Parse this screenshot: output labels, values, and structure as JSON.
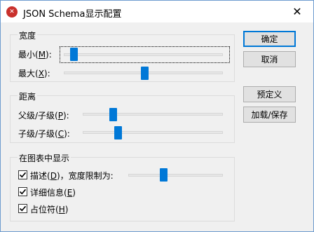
{
  "window": {
    "title": "JSON Schema显示配置",
    "close_glyph": "✕"
  },
  "width_group": {
    "title": "宽度",
    "min_prefix": "最小(",
    "min_key": "M",
    "min_suffix": "):",
    "min_value": 0.04,
    "max_prefix": "最大(",
    "max_key": "X",
    "max_suffix": "):",
    "max_value": 0.51
  },
  "distance_group": {
    "title": "距离",
    "parent_prefix": "父级/子级(",
    "parent_key": "P",
    "parent_suffix": "):",
    "parent_value": 0.2,
    "child_prefix": "子级/子级(",
    "child_key": "C",
    "child_suffix": "):",
    "child_value": 0.24
  },
  "display_group": {
    "title": "在图表中显示",
    "desc_prefix": "描述(",
    "desc_key": "D",
    "desc_suffix": ")，宽度限制为:",
    "desc_checked": true,
    "desc_value": 0.36,
    "detail_prefix": "详细信息(",
    "detail_key": "E",
    "detail_suffix": ")",
    "detail_checked": true,
    "placeholder_prefix": "占位符(",
    "placeholder_key": "H",
    "placeholder_suffix": ")",
    "placeholder_checked": true
  },
  "buttons": {
    "ok": "确定",
    "cancel": "取消",
    "predefined": "预定义",
    "load_save": "加载/保存"
  },
  "colors": {
    "accent": "#0078d7",
    "app_icon": "#c9302c"
  },
  "icons": {
    "app": "xmlspy-app-icon",
    "close": "close-icon",
    "check": "checkmark-icon"
  }
}
